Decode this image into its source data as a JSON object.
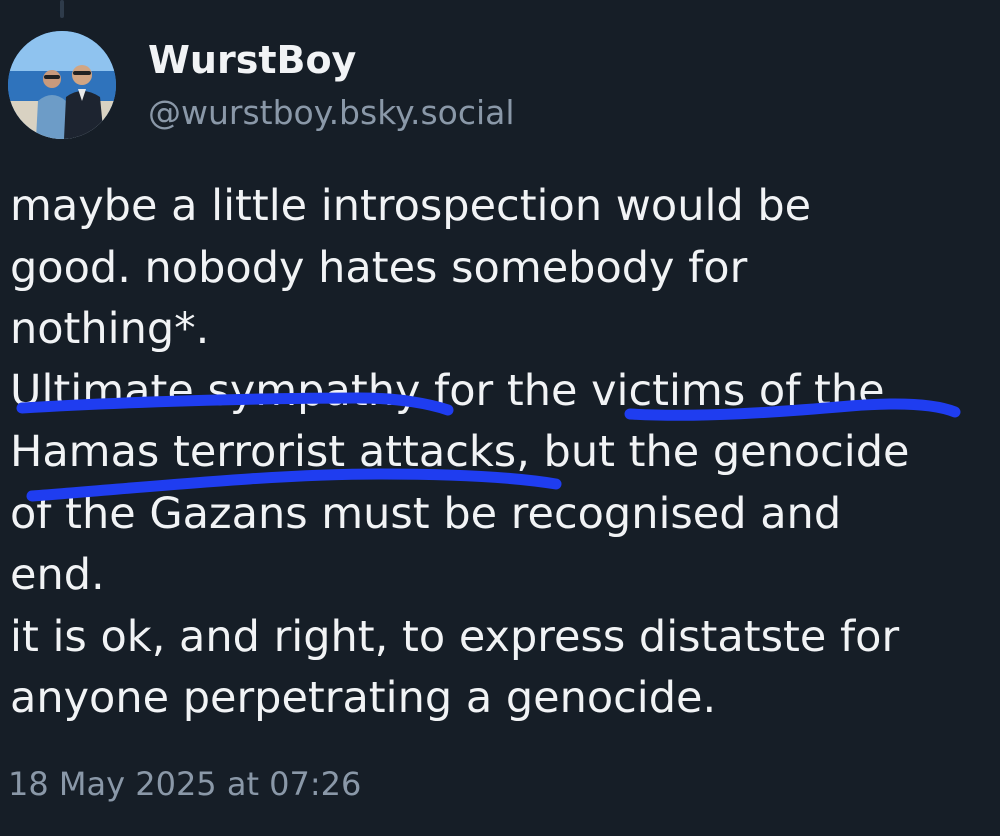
{
  "author": {
    "display_name": "WurstBoy",
    "handle": "@wurstboy.bsky.social"
  },
  "post": {
    "lines": [
      "maybe a little introspection would be",
      "good. nobody hates somebody for",
      "nothing*.",
      "Ultimate sympathy for the victims of the",
      "Hamas terrorist attacks, but the genocide",
      "of the Gazans must be recognised and",
      "end.",
      "it is ok, and right, to express distatste for",
      "anyone perpetrating a genocide."
    ],
    "timestamp": "18 May 2025 at 07:26"
  },
  "colors": {
    "background": "#161e27",
    "text": "#f1f3f5",
    "muted": "#8a98a8",
    "annotation_ink": "#1f3df0"
  }
}
